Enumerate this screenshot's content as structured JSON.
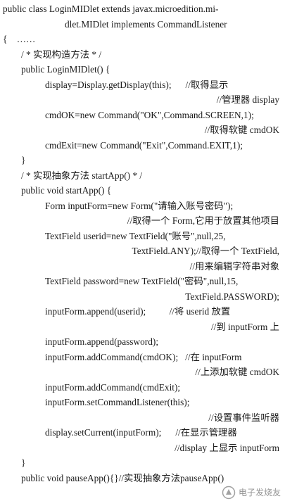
{
  "document": {
    "lines": [
      "public class LoginMIDlet extends javax.microedition.mi-",
      "dlet.MIDlet implements CommandListener",
      "{    ……",
      "/ * 实现构造方法 * /",
      "public LoginMIDlet() {",
      "display=Display.getDisplay(this);      //取得显示",
      "//管理器 display",
      "cmdOK=new Command(\"OK\",Command.SCREEN,1);",
      "//取得软键 cmdOK",
      "cmdExit=new Command(\"Exit\",Command.EXIT,1);",
      "}",
      "/ * 实现抽象方法 startApp() * /",
      "public void startApp() {",
      "Form inputForm=new Form(\"请输入账号密码\");",
      "//取得一个 Form,它用于放置其他项目",
      "TextField userid=new TextField(\"账号\",null,25,",
      "TextField.ANY);//取得一个 TextField,",
      "//用来编辑字符串对象",
      "TextField password=new TextField(\"密码\",null,15,",
      "TextField.PASSWORD);",
      "inputForm.append(userid);          //将 userid 放置",
      "//到 inputForm 上",
      "inputForm.append(password);",
      "inputForm.addCommand(cmdOK);   //在 inputForm",
      "//上添加软键 cmdOK",
      "inputForm.addCommand(cmdExit);",
      "inputForm.setCommandListener(this);",
      "//设置事件监听器",
      "display.setCurrent(inputForm);      //在显示管理器",
      "//display 上显示 inputForm",
      "}",
      "public void pauseApp(){}//实现抽象方法pauseApp()"
    ]
  },
  "watermark": {
    "text": "电子发烧友",
    "icon": "logo-icon"
  }
}
